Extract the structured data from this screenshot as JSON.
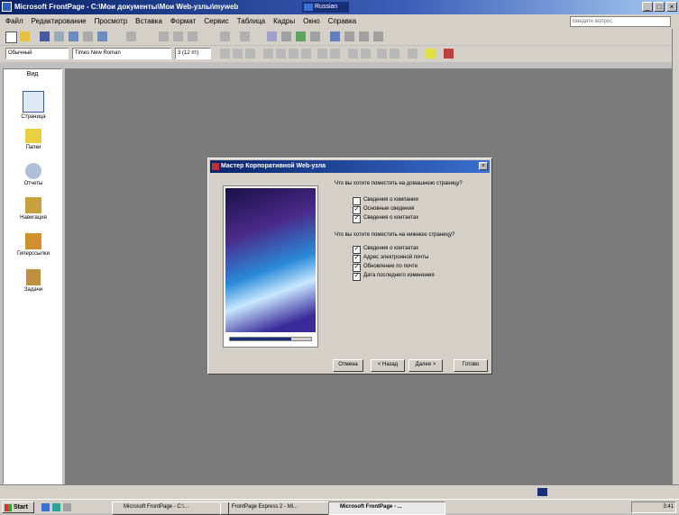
{
  "window": {
    "title": "Microsoft FrontPage - C:\\Мои документы\\Мои Web-узлы\\myweb",
    "language_indicator": "Russian",
    "help_box_placeholder": "Введите вопрос"
  },
  "menu": [
    "Файл",
    "Редактирование",
    "Просмотр",
    "Вставка",
    "Формат",
    "Сервис",
    "Таблица",
    "Кадры",
    "Окно",
    "Справка"
  ],
  "toolbar": {
    "style_value": "Обычный",
    "font_value": "Times New Roman",
    "size_value": "3 (12 пт)"
  },
  "views": [
    {
      "label": "Страница",
      "icon": "page-view-icon"
    },
    {
      "label": "Папки",
      "icon": "folders-view-icon"
    },
    {
      "label": "Отчеты",
      "icon": "reports-view-icon"
    },
    {
      "label": "Навигация",
      "icon": "navigation-view-icon"
    },
    {
      "label": "Гиперссылки",
      "icon": "hyperlinks-view-icon"
    },
    {
      "label": "Задачи",
      "icon": "tasks-view-icon"
    }
  ],
  "views_header": "Вид",
  "dialog": {
    "title": "Мастер Корпоративной Web-узла",
    "question1": "Что вы хотите поместить на домашнюю страницу?",
    "options1": [
      {
        "label": "Сведения о компании",
        "checked": false
      },
      {
        "label": "Основные сведения",
        "checked": true
      },
      {
        "label": "Сведения о контактах",
        "checked": true
      }
    ],
    "question2": "Что вы хотите поместить на нижнюю страницу?",
    "options2": [
      {
        "label": "Сведения о контактах",
        "checked": true
      },
      {
        "label": "Адрес электронной почты",
        "checked": true
      },
      {
        "label": "Обновление по почте",
        "checked": true
      },
      {
        "label": "Дата последнего изменения",
        "checked": true
      }
    ],
    "buttons": {
      "cancel": "Отмена",
      "back": "< Назад",
      "next": "Далее >",
      "finish": "Готово"
    }
  },
  "taskbar": {
    "start": "Start",
    "tasks": [
      "Microsoft FrontPage - C:\\...",
      "FrontPage Express 2 - Mi...",
      "Microsoft FrontPage - ..."
    ],
    "clock": "3:41"
  }
}
